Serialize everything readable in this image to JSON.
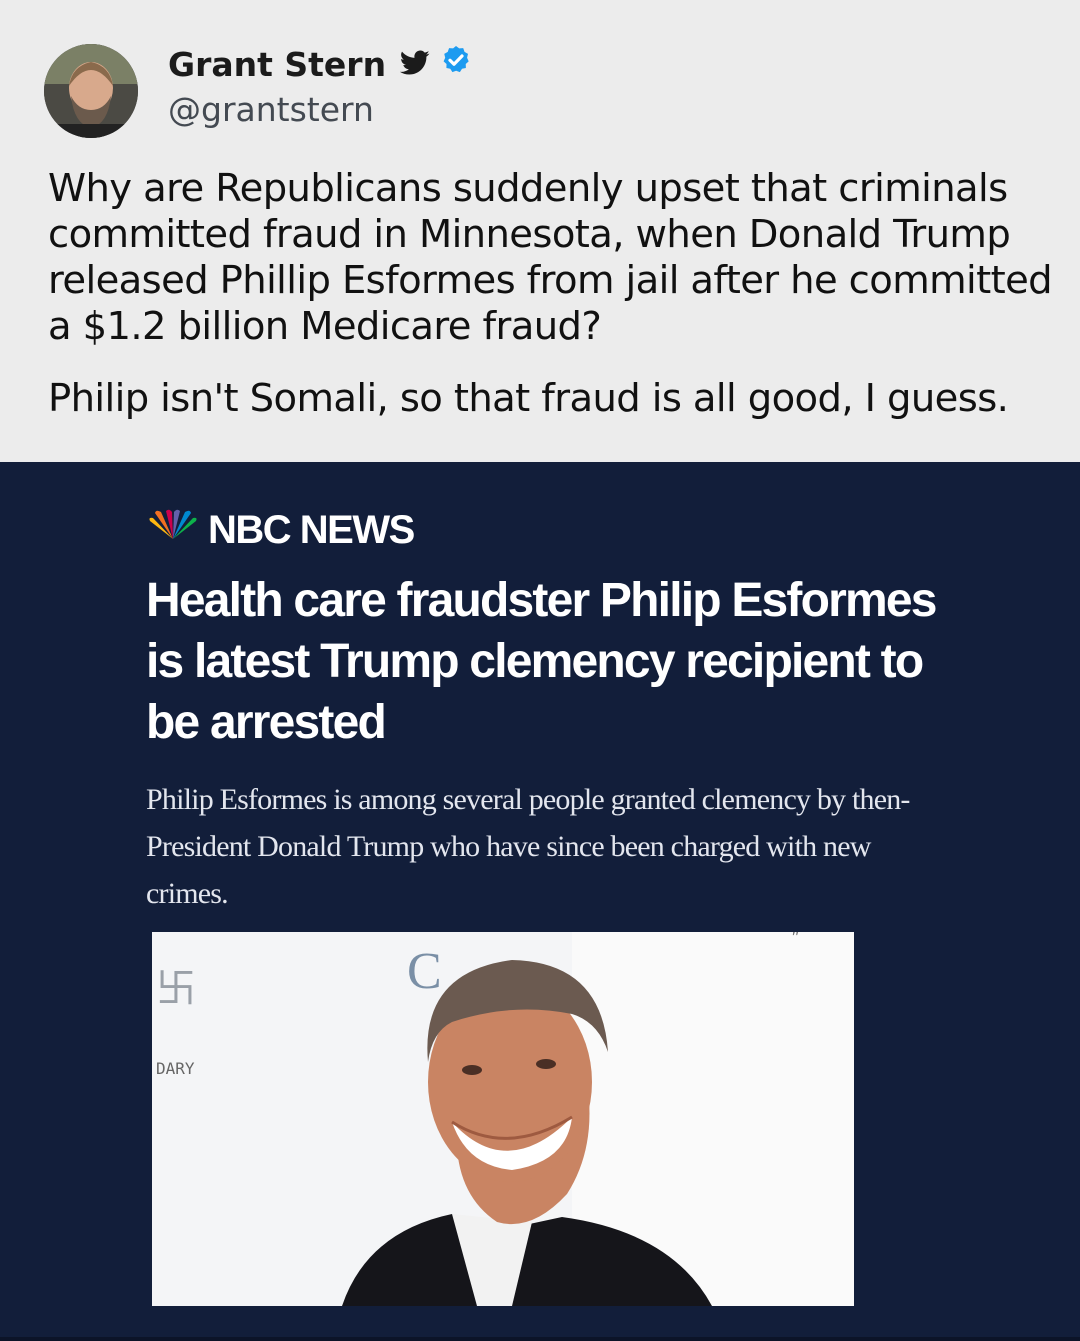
{
  "tweet": {
    "author_name": "Grant Stern",
    "handle": "@grantstern",
    "text_paragraph_1": "Why are Republicans suddenly upset that criminals committed fraud in Minnesota, when Donald Trump released Phillip Esformes from jail after he committed a $1.2 billion Medicare fraud?",
    "text_paragraph_2": "Philip isn't Somali, so that fraud is all good, I guess.",
    "icons": [
      "avatar",
      "twitter-bird-icon",
      "verified-badge-icon"
    ],
    "colors": {
      "background": "#ececec",
      "verified": "#1d9bf0",
      "text": "#111111"
    }
  },
  "article": {
    "source": "NBC NEWS",
    "headline": "Health care fraudster Philip Esformes is latest Trump clemency recipient to be arrested",
    "dek": "Philip Esformes is among several people granted clemency by then-President Donald Trump who have since been charged with new crimes.",
    "photo_backdrop_text": "DARY",
    "icons": [
      "nbc-peacock-icon"
    ],
    "colors": {
      "background": "#121e3a",
      "headline": "#ffffff"
    }
  }
}
